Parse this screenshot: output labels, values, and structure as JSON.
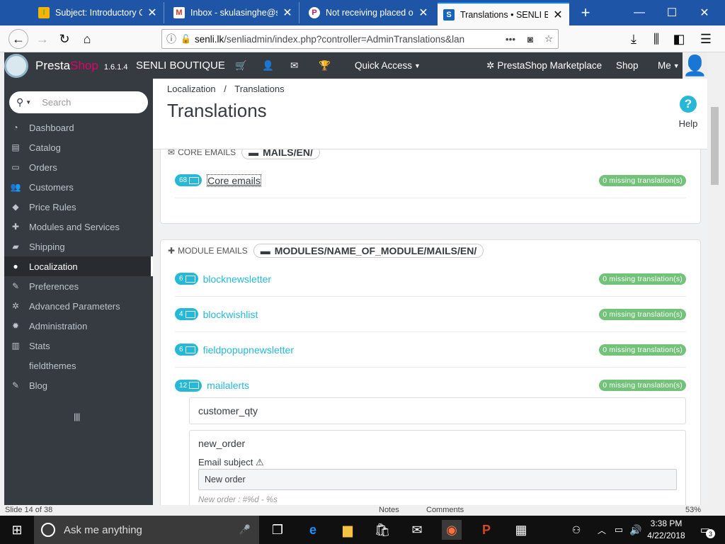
{
  "browser": {
    "tabs": [
      {
        "title": "Subject: Introductory Co",
        "favicon": "I"
      },
      {
        "title": "Inbox - skulasinghe@sen",
        "favicon": "M"
      },
      {
        "title": "Not receiving placed ord",
        "favicon": "P"
      },
      {
        "title": "Translations • SENLI BOU",
        "favicon": "S"
      }
    ],
    "url_host": "senli.lk",
    "url_path": "/senliadmin/index.php?controller=AdminTranslations&lan",
    "url_more": "•••"
  },
  "ps_header": {
    "brand": "PrestaShop",
    "version": "1.6.1.4",
    "shop_name": "SENLI BOUTIQUE",
    "quick_access": "Quick Access",
    "marketplace": "PrestaShop Marketplace",
    "shop": "Shop",
    "me": "Me"
  },
  "sidebar": {
    "search_placeholder": "Search",
    "items": [
      {
        "label": "Dashboard",
        "icon": "dashboard-icon",
        "glyph": "◔"
      },
      {
        "label": "Catalog",
        "icon": "catalog-icon",
        "glyph": "▤"
      },
      {
        "label": "Orders",
        "icon": "orders-icon",
        "glyph": "▭"
      },
      {
        "label": "Customers",
        "icon": "customers-icon",
        "glyph": "👥"
      },
      {
        "label": "Price Rules",
        "icon": "tags-icon",
        "glyph": "◆"
      },
      {
        "label": "Modules and Services",
        "icon": "puzzle-icon",
        "glyph": "✚"
      },
      {
        "label": "Shipping",
        "icon": "truck-icon",
        "glyph": "▰"
      },
      {
        "label": "Localization",
        "icon": "globe-icon",
        "glyph": "●"
      },
      {
        "label": "Preferences",
        "icon": "wrench-icon",
        "glyph": "✎"
      },
      {
        "label": "Advanced Parameters",
        "icon": "cogs-icon",
        "glyph": "✲"
      },
      {
        "label": "Administration",
        "icon": "gear-icon",
        "glyph": "✹"
      },
      {
        "label": "Stats",
        "icon": "stats-icon",
        "glyph": "▥"
      },
      {
        "label": "fieldthemes",
        "icon": "",
        "glyph": ""
      },
      {
        "label": "Blog",
        "icon": "blog-icon",
        "glyph": "✎"
      }
    ],
    "collapse_glyph": "||||"
  },
  "page": {
    "breadcrumb_1": "Localization",
    "breadcrumb_sep": "/",
    "breadcrumb_2": "Translations",
    "title": "Translations",
    "help": "Help"
  },
  "core_emails": {
    "heading": "CORE EMAILS",
    "path": "MAILS/EN/",
    "rows": [
      {
        "count": "68",
        "name": "Core emails",
        "missing": "0 missing translation(s)"
      }
    ]
  },
  "module_emails": {
    "heading": "MODULE EMAILS",
    "path": "MODULES/NAME_OF_MODULE/MAILS/EN/",
    "rows": [
      {
        "count": "6",
        "name": "blocknewsletter",
        "missing": "0 missing translation(s)"
      },
      {
        "count": "4",
        "name": "blockwishlist",
        "missing": "0 missing translation(s)"
      },
      {
        "count": "6",
        "name": "fieldpopupnewsletter",
        "missing": "0 missing translation(s)"
      },
      {
        "count": "12",
        "name": "mailalerts",
        "missing": "0 missing translation(s)"
      }
    ],
    "templates": [
      {
        "name": "customer_qty"
      },
      {
        "name": "new_order",
        "subject_label": "Email subject",
        "subject_value": "New order",
        "preview": "New order : #%d - %s"
      }
    ]
  },
  "ppt_status": {
    "slide": "Slide 14 of 38",
    "notes": "Notes",
    "comments": "Comments",
    "zoom": "53%"
  },
  "taskbar": {
    "search_placeholder": "Ask me anything",
    "time": "3:38 PM",
    "date": "4/22/2018",
    "notifications": "3"
  }
}
